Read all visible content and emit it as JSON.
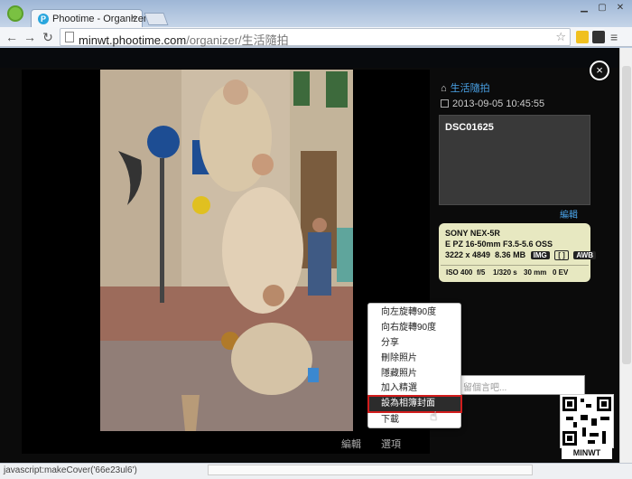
{
  "browser": {
    "tab_title": "Phootime - Organizer",
    "tab_close": "×",
    "url_prefix": "minwt.phootime.com",
    "url_path": "/organizer/生活隨拍",
    "favicon_letter": "P"
  },
  "viewer": {
    "album_name": "生活隨拍",
    "datetime": "2013-09-05 10:45:55",
    "filename": "DSC01625",
    "edit_label": "編輯",
    "close_icon": "×",
    "photo_actions": {
      "edit": "編輯",
      "options": "選項"
    }
  },
  "exif": {
    "camera": "SONY NEX-5R",
    "lens": "E PZ 16-50mm F3.5-5.6 OSS",
    "dimensions": "3222 x 4849",
    "filesize": "8.36 MB",
    "badges": [
      "IMG",
      "[ ]",
      "AWB"
    ],
    "iso": "ISO 400",
    "aperture": "f/5",
    "shutter": "1/320 s",
    "focal": "30 mm",
    "ev": "0 EV"
  },
  "context_menu": {
    "items": [
      "向左旋轉90度",
      "向右旋轉90度",
      "分享",
      "刪除照片",
      "隱藏照片",
      "加入精選",
      "設為相簿封面",
      "下載"
    ],
    "highlighted_index": 6
  },
  "comment": {
    "placeholder": "留個言吧..."
  },
  "status_bar": {
    "text": "javascript:makeCover('66e23ul6')"
  },
  "watermark": {
    "caption": "MINWT"
  }
}
